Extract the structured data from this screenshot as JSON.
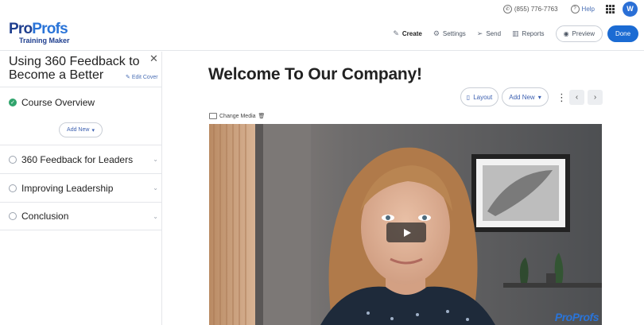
{
  "topbar": {
    "phone": "(855) 776-7763",
    "help": "Help",
    "avatar_initial": "W"
  },
  "logo": {
    "brand_a": "Pro",
    "brand_b": "Profs",
    "product": "Training Maker"
  },
  "header_actions": {
    "create": "Create",
    "settings": "Settings",
    "send": "Send",
    "reports": "Reports",
    "preview": "Preview",
    "done": "Done"
  },
  "sidebar": {
    "title": "Using 360 Feedback to Become a Better",
    "edit_cover": "Edit Cover",
    "overview": "Course Overview",
    "add_new": "Add New",
    "sections": [
      {
        "label": "360 Feedback for Leaders"
      },
      {
        "label": "Improving Leadership"
      },
      {
        "label": "Conclusion"
      }
    ]
  },
  "main": {
    "title": "Welcome To Our Company!",
    "layout": "Layout",
    "add_new": "Add New",
    "change_media": "Change Media",
    "watermark": "ProProfs"
  },
  "colors": {
    "primary": "#1b6bd3",
    "brand_dark": "#1f3f8f",
    "link": "#3b5fb0",
    "success": "#30a46c"
  },
  "icons": [
    "phone-icon",
    "help-icon",
    "apps-grid-icon",
    "pencil-icon",
    "gear-icon",
    "send-icon",
    "bar-chart-icon",
    "eye-icon",
    "close-icon",
    "check-circle-icon",
    "caret-down-icon",
    "layout-icon",
    "kebab-icon",
    "chevron-left-icon",
    "chevron-right-icon",
    "image-icon",
    "trash-icon",
    "play-icon"
  ]
}
